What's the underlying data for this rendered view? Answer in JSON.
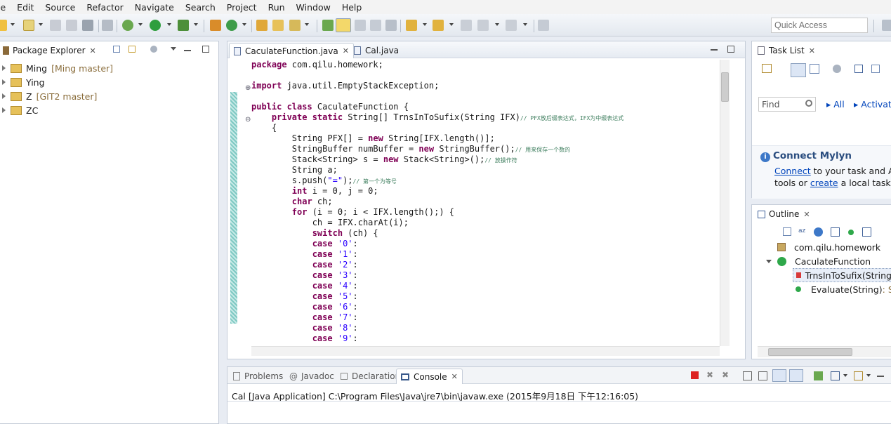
{
  "menu": [
    "le",
    "Edit",
    "Source",
    "Refactor",
    "Navigate",
    "Search",
    "Project",
    "Run",
    "Window",
    "Help"
  ],
  "quick_access": "Quick Access",
  "package_explorer": {
    "title": "Package Explorer",
    "items": [
      {
        "name": "Ming",
        "git": "[Ming master]"
      },
      {
        "name": "Ying",
        "git": ""
      },
      {
        "name": "Z",
        "git": "[GIT2 master]"
      },
      {
        "name": "ZC",
        "git": ""
      }
    ]
  },
  "editor": {
    "tabs": [
      {
        "label": "CaculateFunction.java",
        "active": true
      },
      {
        "label": "Cal.java",
        "active": false
      }
    ]
  },
  "code": [
    {
      "indent": "",
      "parts": [
        [
          "kw",
          "package"
        ],
        [
          "t",
          " com.qilu.homework;"
        ]
      ]
    },
    {
      "indent": "",
      "parts": []
    },
    {
      "indent": "",
      "parts": [
        [
          "kw",
          "import"
        ],
        [
          "t",
          " java.util.EmptyStackException;"
        ]
      ]
    },
    {
      "indent": "",
      "parts": []
    },
    {
      "indent": "",
      "parts": [
        [
          "kw",
          "public class"
        ],
        [
          "t",
          " CaculateFunction {"
        ]
      ]
    },
    {
      "indent": "    ",
      "parts": [
        [
          "kw",
          "private static"
        ],
        [
          "t",
          " String[] TrnsInToSufix(String IFX)"
        ],
        [
          "cm",
          "// PFX放后缀表达式，IFX为中缀表达式"
        ]
      ]
    },
    {
      "indent": "    ",
      "parts": [
        [
          "t",
          "{"
        ]
      ]
    },
    {
      "indent": "        ",
      "parts": [
        [
          "t",
          "String PFX[] = "
        ],
        [
          "kw",
          "new"
        ],
        [
          "t",
          " String[IFX.length()];"
        ]
      ]
    },
    {
      "indent": "        ",
      "parts": [
        [
          "t",
          "StringBuffer numBuffer = "
        ],
        [
          "kw",
          "new"
        ],
        [
          "t",
          " StringBuffer();"
        ],
        [
          "cm",
          "// 用来保存一个数的"
        ]
      ]
    },
    {
      "indent": "        ",
      "parts": [
        [
          "t",
          "Stack<String> s = "
        ],
        [
          "kw",
          "new"
        ],
        [
          "t",
          " Stack<String>();"
        ],
        [
          "cm",
          "// 放操作符"
        ]
      ]
    },
    {
      "indent": "        ",
      "parts": [
        [
          "t",
          "String a;"
        ]
      ]
    },
    {
      "indent": "        ",
      "parts": [
        [
          "t",
          "s.push("
        ],
        [
          "str",
          "\"=\""
        ],
        [
          "t",
          ");"
        ],
        [
          "cm",
          "// 第一个为等号"
        ]
      ]
    },
    {
      "indent": "        ",
      "parts": [
        [
          "kw",
          "int"
        ],
        [
          "t",
          " i = 0, j = 0;"
        ]
      ]
    },
    {
      "indent": "        ",
      "parts": [
        [
          "kw",
          "char"
        ],
        [
          "t",
          " ch;"
        ]
      ]
    },
    {
      "indent": "        ",
      "parts": [
        [
          "kw",
          "for"
        ],
        [
          "t",
          " (i = 0; i < IFX.length();) {"
        ]
      ]
    },
    {
      "indent": "            ",
      "parts": [
        [
          "t",
          "ch = IFX.charAt(i);"
        ]
      ]
    },
    {
      "indent": "            ",
      "parts": [
        [
          "kw",
          "switch"
        ],
        [
          "t",
          " (ch) {"
        ]
      ]
    },
    {
      "indent": "            ",
      "parts": [
        [
          "kw",
          "case"
        ],
        [
          "t",
          " "
        ],
        [
          "str",
          "'0'"
        ],
        [
          "t",
          ":"
        ]
      ]
    },
    {
      "indent": "            ",
      "parts": [
        [
          "kw",
          "case"
        ],
        [
          "t",
          " "
        ],
        [
          "str",
          "'1'"
        ],
        [
          "t",
          ":"
        ]
      ]
    },
    {
      "indent": "            ",
      "parts": [
        [
          "kw",
          "case"
        ],
        [
          "t",
          " "
        ],
        [
          "str",
          "'2'"
        ],
        [
          "t",
          ":"
        ]
      ]
    },
    {
      "indent": "            ",
      "parts": [
        [
          "kw",
          "case"
        ],
        [
          "t",
          " "
        ],
        [
          "str",
          "'3'"
        ],
        [
          "t",
          ":"
        ]
      ]
    },
    {
      "indent": "            ",
      "parts": [
        [
          "kw",
          "case"
        ],
        [
          "t",
          " "
        ],
        [
          "str",
          "'4'"
        ],
        [
          "t",
          ":"
        ]
      ]
    },
    {
      "indent": "            ",
      "parts": [
        [
          "kw",
          "case"
        ],
        [
          "t",
          " "
        ],
        [
          "str",
          "'5'"
        ],
        [
          "t",
          ":"
        ]
      ]
    },
    {
      "indent": "            ",
      "parts": [
        [
          "kw",
          "case"
        ],
        [
          "t",
          " "
        ],
        [
          "str",
          "'6'"
        ],
        [
          "t",
          ":"
        ]
      ]
    },
    {
      "indent": "            ",
      "parts": [
        [
          "kw",
          "case"
        ],
        [
          "t",
          " "
        ],
        [
          "str",
          "'7'"
        ],
        [
          "t",
          ":"
        ]
      ]
    },
    {
      "indent": "            ",
      "parts": [
        [
          "kw",
          "case"
        ],
        [
          "t",
          " "
        ],
        [
          "str",
          "'8'"
        ],
        [
          "t",
          ":"
        ]
      ]
    },
    {
      "indent": "            ",
      "parts": [
        [
          "kw",
          "case"
        ],
        [
          "t",
          " "
        ],
        [
          "str",
          "'9'"
        ],
        [
          "t",
          ":"
        ]
      ]
    }
  ],
  "task_list": {
    "title": "Task List",
    "find_placeholder": "Find",
    "all_label": "All",
    "activate_label": "Activat"
  },
  "mylyn": {
    "title": "Connect Mylyn",
    "connect_link": "Connect",
    "text1": " to your task and AL",
    "text2": "tools or ",
    "create_link": "create",
    "text3": " a local task."
  },
  "outline": {
    "title": "Outline",
    "items": [
      {
        "label": "com.qilu.homework",
        "type": "package"
      },
      {
        "label": "CaculateFunction",
        "type": "class"
      },
      {
        "label": "TrnsInToSufix(String",
        "type": "private-static"
      },
      {
        "label": "Evaluate(String)",
        "suffix": " : St",
        "type": "public-static"
      }
    ]
  },
  "console": {
    "tabs": [
      "Problems",
      "Javadoc",
      "Declaration",
      "Console"
    ],
    "active": "Console",
    "status": "Cal [Java Application] C:\\Program Files\\Java\\jre7\\bin\\javaw.exe (2015年9月18日 下午12:16:05)"
  },
  "colors": {
    "keyword": "#7f0055",
    "string": "#2a00ff",
    "comment": "#3f7f5f",
    "link": "#0044bb"
  }
}
